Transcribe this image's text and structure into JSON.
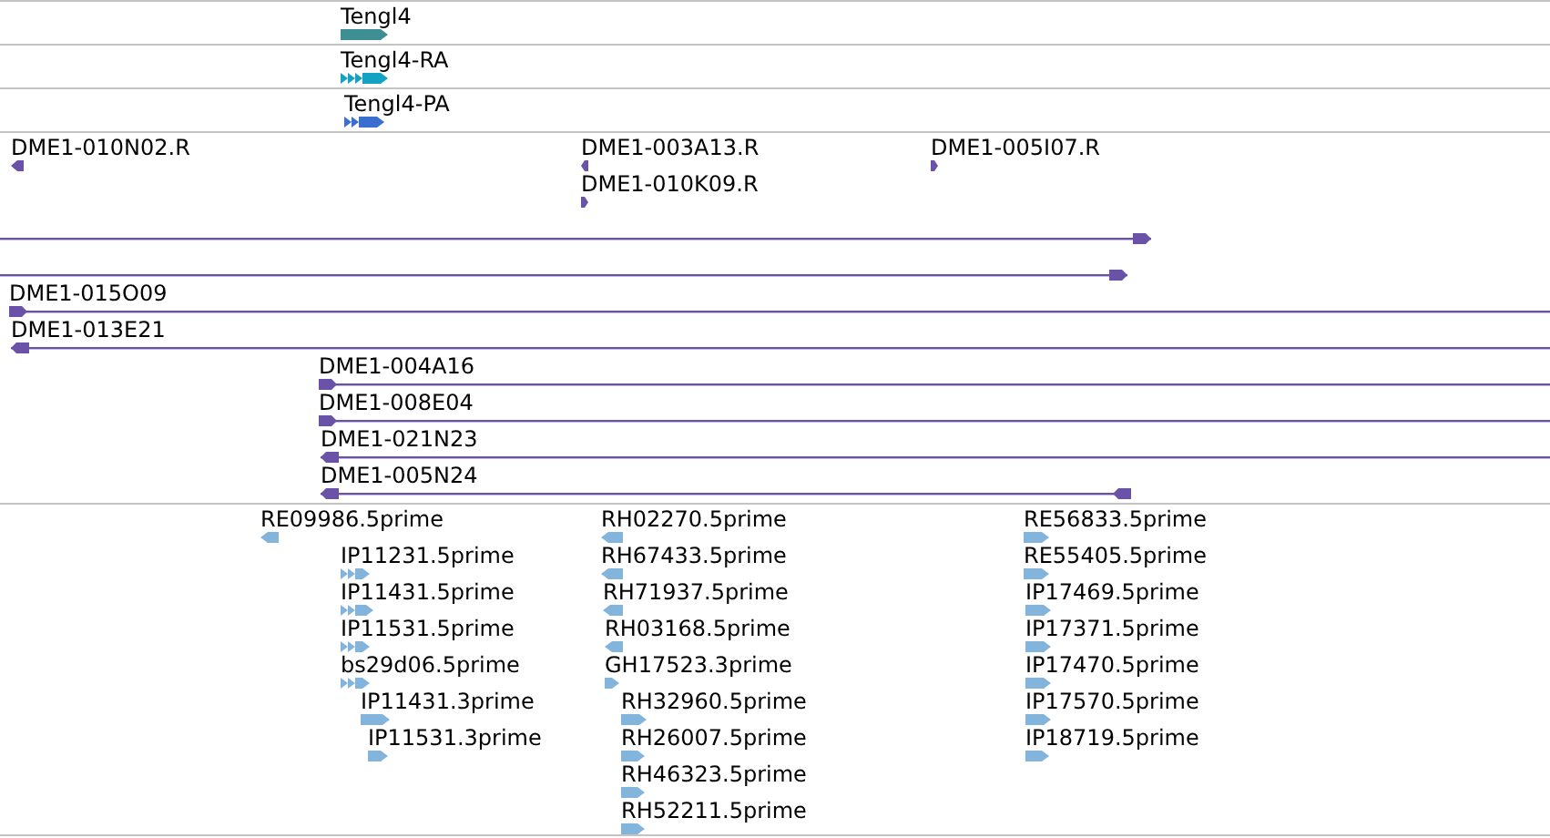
{
  "tracks": [
    {
      "color": "#3d8f93",
      "features": [
        {
          "label": "Tengl4",
          "reverse": false,
          "kind": "block"
        }
      ]
    },
    {
      "color": "#13a2c2",
      "features": [
        {
          "label": "Tengl4-RA",
          "reverse": false,
          "kind": "chevron"
        }
      ]
    },
    {
      "color": "#3a6fd0",
      "features": [
        {
          "label": "Tengl4-PA",
          "reverse": false,
          "kind": "chevron"
        }
      ]
    },
    {
      "color": "#6a52a8",
      "features": [
        {
          "label": "DME1-010N02.R",
          "reverse": true,
          "kind": "block"
        },
        {
          "label": "DME1-003A13.R",
          "reverse": true,
          "kind": "block"
        },
        {
          "label": "DME1-010K09.R",
          "reverse": false,
          "kind": "block"
        },
        {
          "label": "DME1-005I07.R",
          "reverse": false,
          "kind": "block"
        },
        {
          "reverse": false,
          "kind": "line"
        },
        {
          "reverse": false,
          "kind": "line"
        },
        {
          "label": "DME1-015O09",
          "reverse": false,
          "kind": "line"
        },
        {
          "label": "DME1-013E21",
          "reverse": true,
          "kind": "line"
        },
        {
          "label": "DME1-004A16",
          "reverse": false,
          "kind": "line"
        },
        {
          "label": "DME1-008E04",
          "reverse": false,
          "kind": "line"
        },
        {
          "label": "DME1-021N23",
          "reverse": true,
          "kind": "line"
        },
        {
          "label": "DME1-005N24",
          "reverse": true,
          "kind": "line"
        }
      ]
    },
    {
      "color": "#82b4dc",
      "features": [
        {
          "label": "RE09986.5prime",
          "reverse": true,
          "kind": "block"
        },
        {
          "label": "IP11231.5prime",
          "reverse": false,
          "kind": "chevron"
        },
        {
          "label": "IP11431.5prime",
          "reverse": false,
          "kind": "chevron"
        },
        {
          "label": "IP11531.5prime",
          "reverse": false,
          "kind": "chevron"
        },
        {
          "label": "bs29d06.5prime",
          "reverse": false,
          "kind": "chevron"
        },
        {
          "label": "IP11431.3prime",
          "reverse": false,
          "kind": "block"
        },
        {
          "label": "IP11531.3prime",
          "reverse": false,
          "kind": "block"
        },
        {
          "label": "RH02270.5prime",
          "reverse": true,
          "kind": "block"
        },
        {
          "label": "RH67433.5prime",
          "reverse": true,
          "kind": "block"
        },
        {
          "label": "RH71937.5prime",
          "reverse": true,
          "kind": "block"
        },
        {
          "label": "RH03168.5prime",
          "reverse": true,
          "kind": "block"
        },
        {
          "label": "GH17523.3prime",
          "reverse": false,
          "kind": "block"
        },
        {
          "label": "RH32960.5prime",
          "reverse": false,
          "kind": "block"
        },
        {
          "label": "RH26007.5prime",
          "reverse": false,
          "kind": "block"
        },
        {
          "label": "RH46323.5prime",
          "reverse": false,
          "kind": "block"
        },
        {
          "label": "RH52211.5prime",
          "reverse": false,
          "kind": "block"
        },
        {
          "label": "RE56833.5prime",
          "reverse": false,
          "kind": "block"
        },
        {
          "label": "RE55405.5prime",
          "reverse": false,
          "kind": "block"
        },
        {
          "label": "IP17469.5prime",
          "reverse": false,
          "kind": "block"
        },
        {
          "label": "IP17371.5prime",
          "reverse": false,
          "kind": "block"
        },
        {
          "label": "IP17470.5prime",
          "reverse": false,
          "kind": "block"
        },
        {
          "label": "IP17570.5prime",
          "reverse": false,
          "kind": "block"
        },
        {
          "label": "IP18719.5prime",
          "reverse": false,
          "kind": "block"
        }
      ]
    }
  ]
}
